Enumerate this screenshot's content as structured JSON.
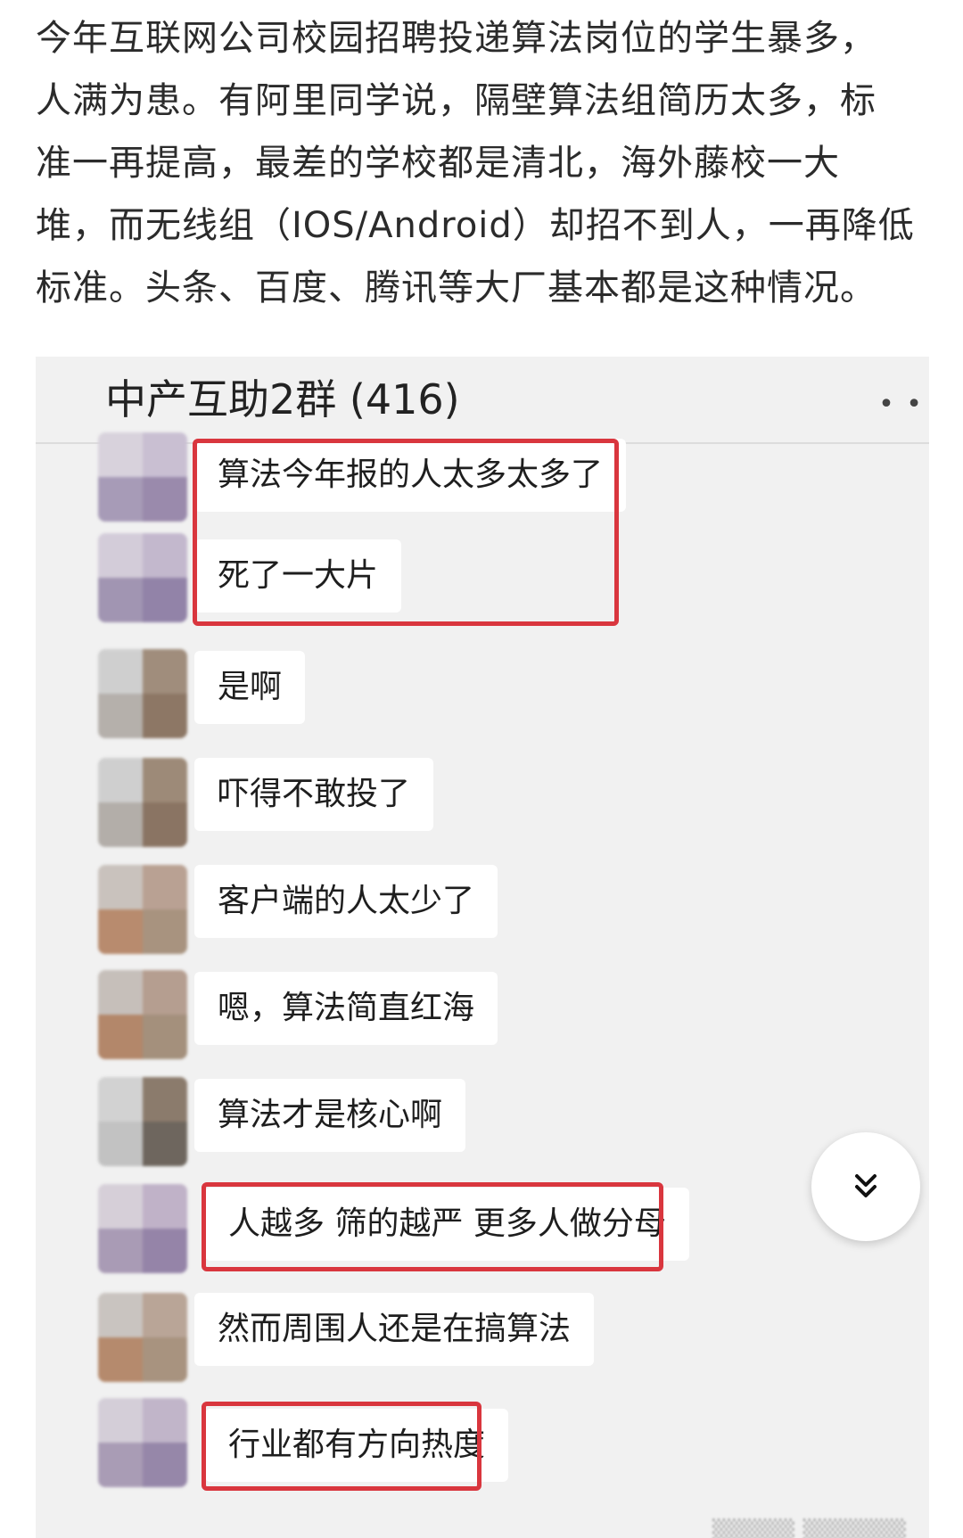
{
  "article": {
    "lines": [
      "今年互联网公司校园招聘投递算法岗位的学生暴多，",
      "人满为患。有阿里同学说，隔壁算法组简历太多，标",
      "准一再提高，最差的学校都是清北，海外藤校一大",
      "堆，而无线组（IOS/Android）却招不到人，一再降低",
      "标准。头条、百度、腾讯等大厂基本都是这种情况。"
    ]
  },
  "chat": {
    "title": "中产互助2群 (416)",
    "more_icon": "more-dots-icon",
    "highlight_color": "#d9363e",
    "messages": [
      {
        "text": "算法今年报的人太多太多了",
        "highlighted": true
      },
      {
        "text": "死了一大片",
        "highlighted": true
      },
      {
        "text": "是啊",
        "highlighted": false
      },
      {
        "text": "吓得不敢投了",
        "highlighted": false
      },
      {
        "text": "客户端的人太少了",
        "highlighted": false
      },
      {
        "text": "嗯，算法简直红海",
        "highlighted": false
      },
      {
        "text": "算法才是核心啊",
        "highlighted": false
      },
      {
        "text": "人越多  筛的越严  更多人做分母",
        "highlighted": true
      },
      {
        "text": "然而周围人还是在搞算法",
        "highlighted": false
      },
      {
        "text": "行业都有方向热度",
        "highlighted": true
      }
    ]
  },
  "scroll_button": {
    "icon": "double-chevron-down-icon"
  }
}
